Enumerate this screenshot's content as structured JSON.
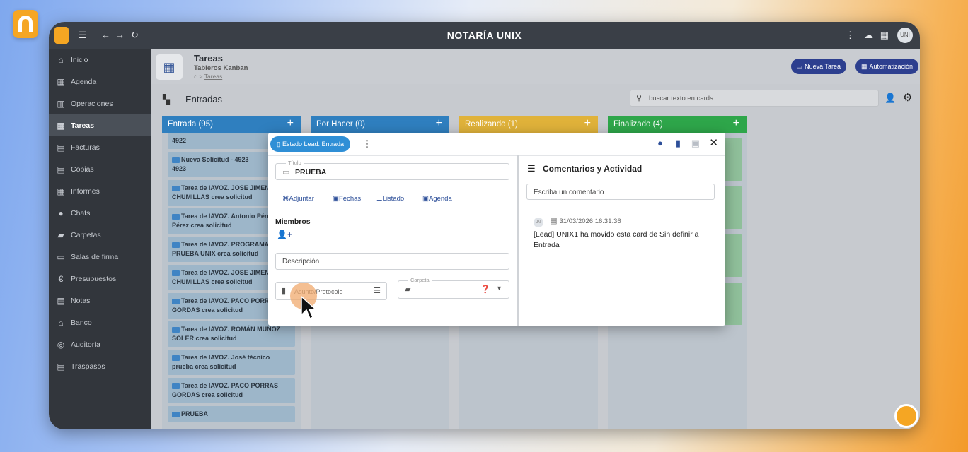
{
  "app": {
    "title": "NOTARÍA UNIX",
    "avatar": "UNI"
  },
  "sidebar": {
    "items": [
      {
        "label": "Inicio",
        "icon": "home-icon",
        "glyph": "⌂"
      },
      {
        "label": "Agenda",
        "icon": "calendar-icon",
        "glyph": "▦"
      },
      {
        "label": "Operaciones",
        "icon": "operations-icon",
        "glyph": "▥"
      },
      {
        "label": "Tareas",
        "icon": "tasks-icon",
        "glyph": "▦"
      },
      {
        "label": "Facturas",
        "icon": "invoice-icon",
        "glyph": "▤"
      },
      {
        "label": "Copias",
        "icon": "copy-icon",
        "glyph": "▤"
      },
      {
        "label": "Informes",
        "icon": "reports-icon",
        "glyph": "▦"
      },
      {
        "label": "Chats",
        "icon": "chat-icon",
        "glyph": "●"
      },
      {
        "label": "Carpetas",
        "icon": "folder-icon",
        "glyph": "▰"
      },
      {
        "label": "Salas de firma",
        "icon": "signature-room-icon",
        "glyph": "▭"
      },
      {
        "label": "Presupuestos",
        "icon": "euro-icon",
        "glyph": "€"
      },
      {
        "label": "Notas",
        "icon": "notes-icon",
        "glyph": "▤"
      },
      {
        "label": "Banco",
        "icon": "bank-icon",
        "glyph": "⌂"
      },
      {
        "label": "Auditoría",
        "icon": "audit-icon",
        "glyph": "◎"
      },
      {
        "label": "Traspasos",
        "icon": "transfer-icon",
        "glyph": "▤"
      }
    ],
    "active_index": 3
  },
  "header": {
    "title": "Tareas",
    "subtitle": "Tableros Kanban",
    "crumb": "Tareas",
    "nueva_tarea": "Nueva Tarea",
    "automatizacion": "Automatización"
  },
  "board": {
    "title": "Entradas",
    "search_placeholder": "buscar texto en cards"
  },
  "columns": [
    {
      "title": "Entrada (95)",
      "color": "#2f7fbf"
    },
    {
      "title": "Por Hacer (0)",
      "color": "#2f7fbf"
    },
    {
      "title": "Realizando (1)",
      "color": "#e0b23a"
    },
    {
      "title": "Finalizado (4)",
      "color": "#2ea64a"
    }
  ],
  "cards": [
    {
      "text": "4922"
    },
    {
      "text": "Nueva Solicitud - 4923",
      "sub": "4923"
    },
    {
      "text": "Tarea de IAVOZ. JOSE JIMENEZ CHUMILLAS crea solicitud"
    },
    {
      "text": "Tarea de IAVOZ. Antonio Pérez Pérez crea solicitud"
    },
    {
      "text": "Tarea de IAVOZ. PROGRAMA PRUEBA UNIX crea solicitud"
    },
    {
      "text": "Tarea de IAVOZ. JOSE JIMENEZ CHUMILLAS crea solicitud"
    },
    {
      "text": "Tarea de IAVOZ. PACO PORRAS GORDAS crea solicitud"
    },
    {
      "text": "Tarea de IAVOZ. ROMÁN MUÑOZ SOLER crea solicitud"
    },
    {
      "text": "Tarea de IAVOZ. José técnico prueba crea solicitud"
    },
    {
      "text": "Tarea de IAVOZ. PACO PORRAS GORDAS crea solicitud"
    },
    {
      "text": "PRUEBA"
    }
  ],
  "modal": {
    "status_pill": "Estado Lead: Entrada",
    "titulo_label": "Título",
    "titulo_value": "PRUEBA",
    "actions": [
      "Adjuntar",
      "Fechas",
      "Listado",
      "Agenda"
    ],
    "miembros": "Miembros",
    "descripcion_placeholder": "Descripción",
    "asunto_placeholder": "Asunto/Protocolo",
    "carpeta_label": "Carpeta",
    "comments_title": "Comentarios y Actividad",
    "comment_placeholder": "Escriba un comentario",
    "activity": {
      "avatar": "UNI",
      "timestamp": "31/03/2026 16:31:36",
      "text": "[Lead] UNIX1 ha movido esta card de Sin definir a Entrada"
    }
  }
}
